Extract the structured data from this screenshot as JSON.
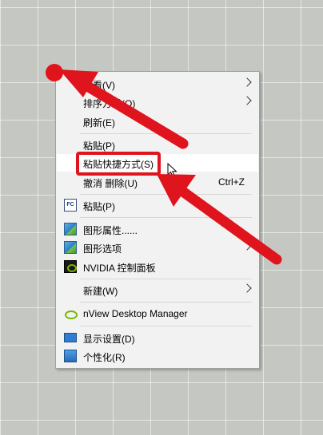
{
  "menu": {
    "items": [
      {
        "label": "查看(V)",
        "submenu": true
      },
      {
        "label": "排序方式(O)",
        "submenu": true
      },
      {
        "label": "刷新(E)"
      },
      {
        "label": "粘贴(P)"
      },
      {
        "label": "粘贴快捷方式(S)",
        "highlighted": true
      },
      {
        "label": "撤消 删除(U)",
        "shortcut": "Ctrl+Z"
      },
      {
        "label": "粘贴(P)",
        "icon": "fastcopy-fc-icon",
        "icon_text": "FC"
      },
      {
        "label": "图形属性......",
        "icon": "intel-graphics-icon"
      },
      {
        "label": "图形选项",
        "icon": "intel-graphics-icon",
        "submenu": true
      },
      {
        "label": "NVIDIA 控制面板",
        "icon": "nvidia-icon"
      },
      {
        "label": "新建(W)",
        "submenu": true
      },
      {
        "label": "nView Desktop Manager",
        "icon": "nview-icon"
      },
      {
        "label": "显示设置(D)",
        "icon": "display-icon"
      },
      {
        "label": "个性化(R)",
        "icon": "personalize-icon"
      }
    ]
  },
  "colors": {
    "annotation_red": "#e0141c",
    "menu_background": "#f2f2f2",
    "desktop_background": "#c5c8c2",
    "nvidia_green": "#76b900"
  }
}
